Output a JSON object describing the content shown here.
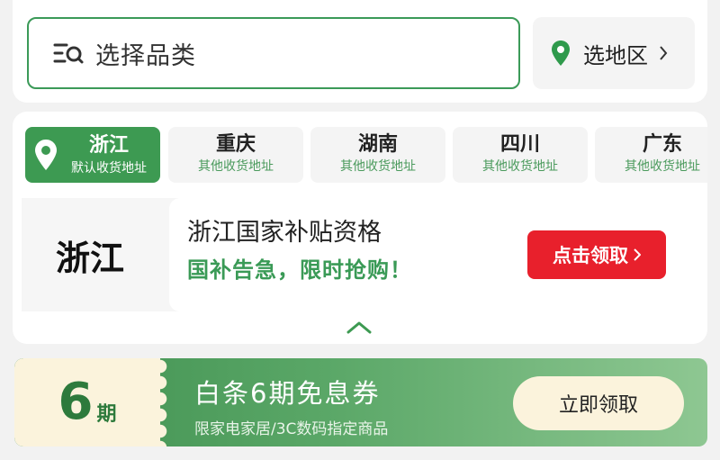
{
  "search": {
    "placeholder": "选择品类"
  },
  "region": {
    "label": "选地区"
  },
  "tabs": [
    {
      "name": "浙江",
      "sub": "默认收货地址"
    },
    {
      "name": "重庆",
      "sub": "其他收货地址"
    },
    {
      "name": "湖南",
      "sub": "其他收货地址"
    },
    {
      "name": "四川",
      "sub": "其他收货地址"
    },
    {
      "name": "广东",
      "sub": "其他收货地址"
    }
  ],
  "province": {
    "name": "浙江",
    "eligibility": "浙江国家补贴资格",
    "urgent": "国补告急，限时抢购！",
    "claim_label": "点击领取"
  },
  "coupon": {
    "period_number": "6",
    "period_unit": "期",
    "title": "白条6期免息券",
    "desc": "限家电家居/3C数码指定商品",
    "button": "立即领取"
  },
  "colors": {
    "accent_green": "#3d9a52",
    "claim_red": "#e8202c",
    "coupon_cream": "#fbf3dc"
  }
}
